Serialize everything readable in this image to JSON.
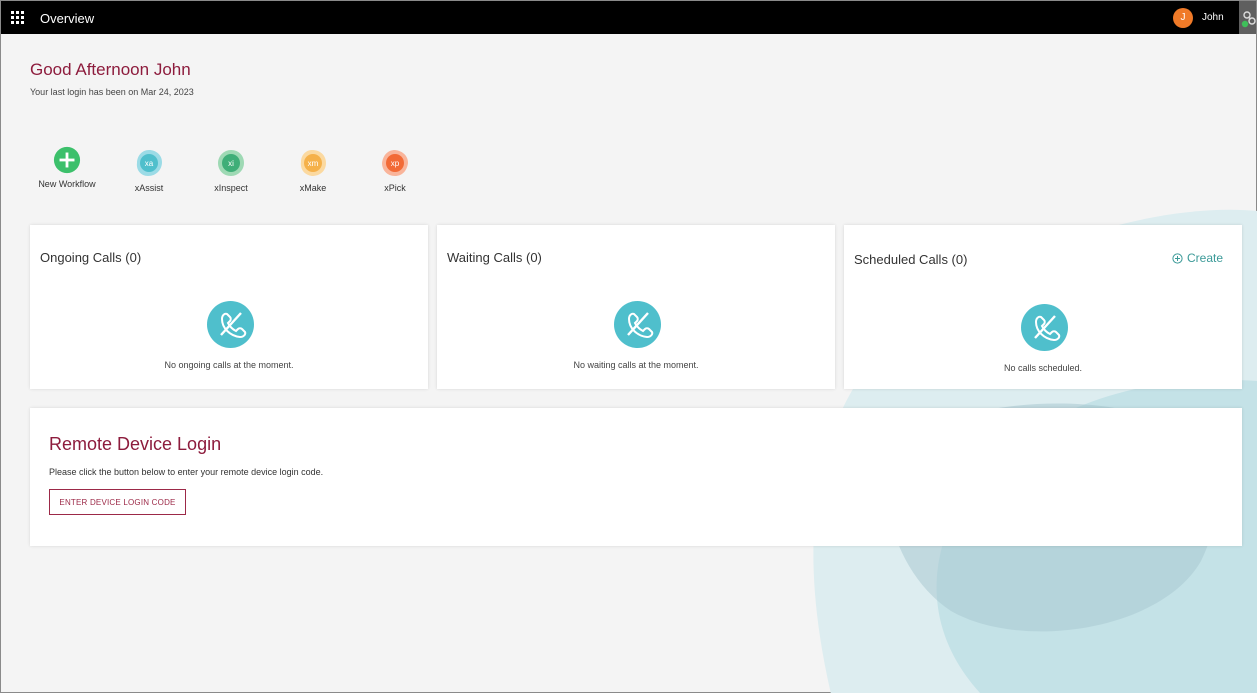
{
  "topbar": {
    "title": "Overview",
    "user_initial": "J",
    "user_name": "John",
    "avatar_color": "#f07a28"
  },
  "greeting": "Good Afternoon John",
  "last_login": "Your last login has been on Mar 24, 2023",
  "apps": [
    {
      "label": "New Workflow",
      "icon": "plus-circle-icon"
    },
    {
      "label": "xAssist",
      "icon": "xassist-app-icon",
      "badge": "xa"
    },
    {
      "label": "xInspect",
      "icon": "xinspect-app-icon",
      "badge": "xi"
    },
    {
      "label": "xMake",
      "icon": "xmake-app-icon",
      "badge": "xm"
    },
    {
      "label": "xPick",
      "icon": "xpick-app-icon",
      "badge": "xp"
    }
  ],
  "cards": {
    "ongoing": {
      "title": "Ongoing Calls (0)",
      "empty": "No ongoing calls at the moment."
    },
    "waiting": {
      "title": "Waiting Calls (0)",
      "empty": "No waiting calls at the moment."
    },
    "scheduled": {
      "title": "Scheduled Calls (0)",
      "empty": "No calls scheduled.",
      "create": "Create"
    }
  },
  "remote": {
    "title": "Remote Device Login",
    "description": "Please click the button below to enter your remote device login code.",
    "button": "ENTER DEVICE LOGIN CODE"
  },
  "colors": {
    "accent": "#8d1c3d",
    "teal": "#4fbfcc",
    "create": "#3b9a98"
  }
}
